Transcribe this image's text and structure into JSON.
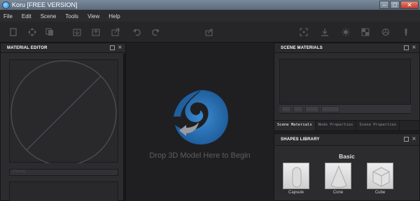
{
  "window": {
    "title": "Koru [FREE VERSION]",
    "minimize_glyph": "–",
    "maximize_glyph": "□",
    "close_glyph": "✕"
  },
  "menu": {
    "items": [
      "File",
      "Edit",
      "Scene",
      "Tools",
      "View",
      "Help"
    ]
  },
  "toolbar": {
    "icons": [
      "new-icon",
      "move-icon",
      "copy-icon",
      "import-icon",
      "export-icon",
      "undo-icon",
      "redo-icon",
      "share-icon",
      "center-icon",
      "ground-icon",
      "lighting-icon",
      "checker-icon",
      "rotate-icon",
      "brush-icon"
    ]
  },
  "material_editor": {
    "title": "MATERIAL EDITOR",
    "input_placeholder": "(None)"
  },
  "viewport": {
    "drop_text": "Drop 3D Model Here to Begin"
  },
  "scene_materials": {
    "title": "SCENE MATERIALS",
    "tabs": [
      "Scene Materials",
      "Node Properties",
      "Scene Properties"
    ],
    "active_tab": "Scene Materials"
  },
  "shapes_library": {
    "title": "SHAPES LIBRARY",
    "category": "Basic",
    "shapes": [
      "Capsule",
      "Cone",
      "Cube"
    ]
  },
  "colors": {
    "accent": "#2f7fc0",
    "logo_blue": "#2a6fb0",
    "panel_bg": "#2c2c2f",
    "viewport_bg": "#1f1f22"
  }
}
